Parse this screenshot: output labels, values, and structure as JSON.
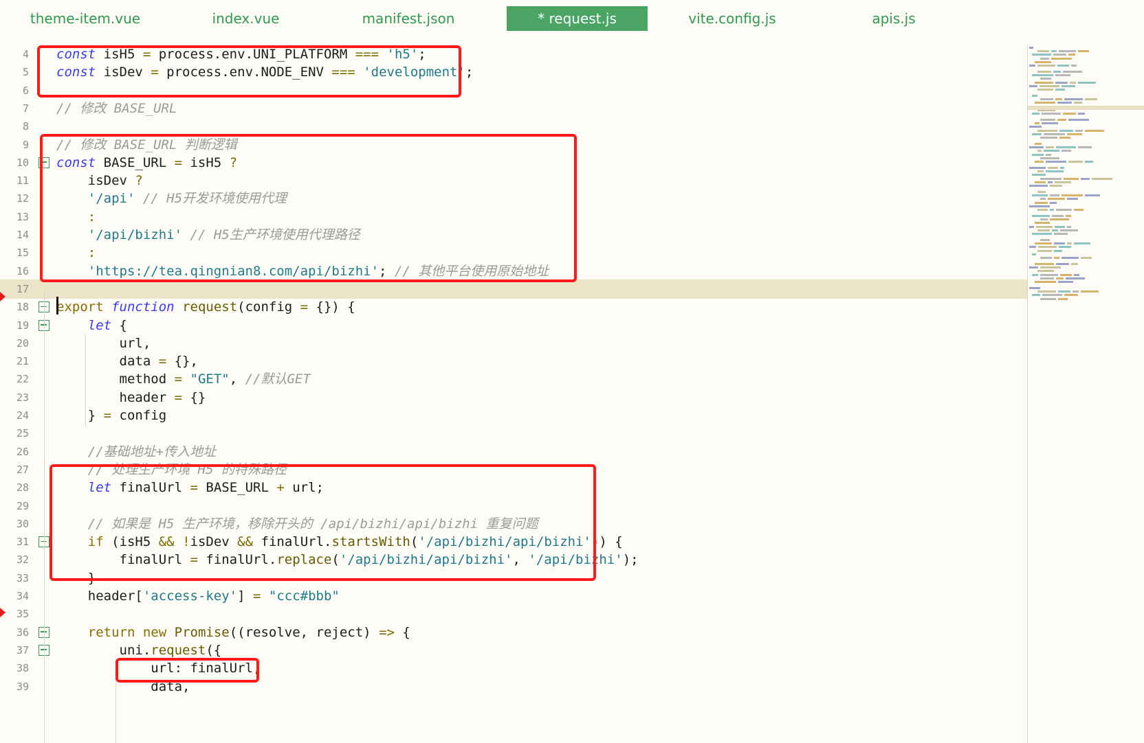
{
  "tabs": [
    {
      "label": "theme-item.vue",
      "active": false
    },
    {
      "label": "index.vue",
      "active": false
    },
    {
      "label": "manifest.json",
      "active": false
    },
    {
      "label": "* request.js",
      "active": true
    },
    {
      "label": "vite.config.js",
      "active": false
    },
    {
      "label": "apis.js",
      "active": false
    }
  ],
  "editor": {
    "current_line": 17,
    "lines": [
      {
        "n": "4",
        "tokens": [
          [
            "kw",
            "const"
          ],
          [
            "pl",
            " isH5 "
          ],
          [
            "op",
            "="
          ],
          [
            "pl",
            " process.env.UNI_PLATFORM "
          ],
          [
            "op",
            "==="
          ],
          [
            "pl",
            " "
          ],
          [
            "str",
            "'h5'"
          ],
          [
            "pl",
            ";"
          ]
        ]
      },
      {
        "n": "5",
        "tokens": [
          [
            "kw",
            "const"
          ],
          [
            "pl",
            " isDev "
          ],
          [
            "op",
            "="
          ],
          [
            "pl",
            " process.env.NODE_ENV "
          ],
          [
            "op",
            "==="
          ],
          [
            "pl",
            " "
          ],
          [
            "str",
            "'development'"
          ],
          [
            "pl",
            ";"
          ]
        ]
      },
      {
        "n": "6",
        "tokens": []
      },
      {
        "n": "7",
        "tokens": [
          [
            "cm",
            "// 修改 BASE_URL"
          ]
        ]
      },
      {
        "n": "8",
        "tokens": []
      },
      {
        "n": "9",
        "tokens": [
          [
            "cm",
            "// 修改 BASE_URL 判断逻辑"
          ]
        ]
      },
      {
        "n": "10",
        "fold": true,
        "tokens": [
          [
            "kw",
            "const"
          ],
          [
            "pl",
            " BASE_URL "
          ],
          [
            "op",
            "="
          ],
          [
            "pl",
            " isH5 "
          ],
          [
            "op",
            "?"
          ]
        ]
      },
      {
        "n": "11",
        "tokens": [
          [
            "pl",
            "    isDev "
          ],
          [
            "op",
            "?"
          ]
        ]
      },
      {
        "n": "12",
        "tokens": [
          [
            "pl",
            "    "
          ],
          [
            "str",
            "'/api'"
          ],
          [
            "pl",
            " "
          ],
          [
            "cm",
            "// H5开发环境使用代理"
          ]
        ]
      },
      {
        "n": "13",
        "tokens": [
          [
            "pl",
            "    "
          ],
          [
            "op",
            ":"
          ]
        ]
      },
      {
        "n": "14",
        "tokens": [
          [
            "pl",
            "    "
          ],
          [
            "str",
            "'/api/bizhi'"
          ],
          [
            "pl",
            " "
          ],
          [
            "cm",
            "// H5生产环境使用代理路径"
          ]
        ]
      },
      {
        "n": "15",
        "tokens": [
          [
            "pl",
            "    "
          ],
          [
            "op",
            ":"
          ]
        ]
      },
      {
        "n": "16",
        "tokens": [
          [
            "pl",
            "    "
          ],
          [
            "str",
            "'https://tea.qingnian8.com/api/bizhi'"
          ],
          [
            "pl",
            "; "
          ],
          [
            "cm",
            "// 其他平台使用原始地址"
          ]
        ]
      },
      {
        "n": "17",
        "tokens": []
      },
      {
        "n": "18",
        "fold": true,
        "tokens": [
          [
            "kw2",
            "export"
          ],
          [
            "pl",
            " "
          ],
          [
            "kw",
            "function"
          ],
          [
            "pl",
            " "
          ],
          [
            "fn",
            "request"
          ],
          [
            "pl",
            "(config "
          ],
          [
            "op",
            "="
          ],
          [
            "pl",
            " {}) {"
          ]
        ]
      },
      {
        "n": "19",
        "fold": true,
        "tokens": [
          [
            "pl",
            "    "
          ],
          [
            "kw",
            "let"
          ],
          [
            "pl",
            " {"
          ]
        ]
      },
      {
        "n": "20",
        "tokens": [
          [
            "pl",
            "        url,"
          ]
        ]
      },
      {
        "n": "21",
        "tokens": [
          [
            "pl",
            "        data "
          ],
          [
            "op",
            "="
          ],
          [
            "pl",
            " {},"
          ]
        ]
      },
      {
        "n": "22",
        "tokens": [
          [
            "pl",
            "        method "
          ],
          [
            "op",
            "="
          ],
          [
            "pl",
            " "
          ],
          [
            "str",
            "\"GET\""
          ],
          [
            "pl",
            ", "
          ],
          [
            "cm",
            "//默认GET"
          ]
        ]
      },
      {
        "n": "23",
        "tokens": [
          [
            "pl",
            "        header "
          ],
          [
            "op",
            "="
          ],
          [
            "pl",
            " {}"
          ]
        ]
      },
      {
        "n": "24",
        "tokens": [
          [
            "pl",
            "    } "
          ],
          [
            "op",
            "="
          ],
          [
            "pl",
            " config"
          ]
        ]
      },
      {
        "n": "25",
        "tokens": []
      },
      {
        "n": "26",
        "tokens": [
          [
            "pl",
            "    "
          ],
          [
            "cm",
            "//基础地址+传入地址"
          ]
        ]
      },
      {
        "n": "27",
        "tokens": [
          [
            "pl",
            "    "
          ],
          [
            "cm",
            "// 处理生产环境 H5 的特殊路径"
          ]
        ]
      },
      {
        "n": "28",
        "tokens": [
          [
            "pl",
            "    "
          ],
          [
            "kw",
            "let"
          ],
          [
            "pl",
            " finalUrl "
          ],
          [
            "op",
            "="
          ],
          [
            "pl",
            " BASE_URL "
          ],
          [
            "op",
            "+"
          ],
          [
            "pl",
            " url;"
          ]
        ]
      },
      {
        "n": "29",
        "tokens": []
      },
      {
        "n": "30",
        "tokens": [
          [
            "pl",
            "    "
          ],
          [
            "cm",
            "// 如果是 H5 生产环境，移除开头的 /api/bizhi/api/bizhi 重复问题"
          ]
        ]
      },
      {
        "n": "31",
        "fold": true,
        "tokens": [
          [
            "pl",
            "    "
          ],
          [
            "kw2",
            "if"
          ],
          [
            "pl",
            " (isH5 "
          ],
          [
            "op",
            "&&"
          ],
          [
            "pl",
            " "
          ],
          [
            "op",
            "!"
          ],
          [
            "pl",
            "isDev "
          ],
          [
            "op",
            "&&"
          ],
          [
            "pl",
            " finalUrl."
          ],
          [
            "fn",
            "startsWith"
          ],
          [
            "pl",
            "("
          ],
          [
            "str",
            "'/api/bizhi/api/bizhi'"
          ],
          [
            "pl",
            ")) {"
          ]
        ]
      },
      {
        "n": "32",
        "tokens": [
          [
            "pl",
            "        finalUrl "
          ],
          [
            "op",
            "="
          ],
          [
            "pl",
            " finalUrl."
          ],
          [
            "fn",
            "replace"
          ],
          [
            "pl",
            "("
          ],
          [
            "str",
            "'/api/bizhi/api/bizhi'"
          ],
          [
            "pl",
            ", "
          ],
          [
            "str",
            "'/api/bizhi'"
          ],
          [
            "pl",
            ");"
          ]
        ]
      },
      {
        "n": "33",
        "tokens": [
          [
            "pl",
            "    }"
          ]
        ]
      },
      {
        "n": "34",
        "tokens": [
          [
            "pl",
            "    header["
          ],
          [
            "str",
            "'access-key'"
          ],
          [
            "pl",
            "] "
          ],
          [
            "op",
            "="
          ],
          [
            "pl",
            " "
          ],
          [
            "str",
            "\"ccc#bbb\""
          ]
        ]
      },
      {
        "n": "35",
        "tokens": []
      },
      {
        "n": "36",
        "fold": true,
        "tokens": [
          [
            "pl",
            "    "
          ],
          [
            "kw2",
            "return"
          ],
          [
            "pl",
            " "
          ],
          [
            "kw2",
            "new"
          ],
          [
            "pl",
            " "
          ],
          [
            "fn",
            "Promise"
          ],
          [
            "pl",
            "((resolve, reject) "
          ],
          [
            "op",
            "=>"
          ],
          [
            "pl",
            " {"
          ]
        ]
      },
      {
        "n": "37",
        "fold": true,
        "tokens": [
          [
            "pl",
            "        uni."
          ],
          [
            "fn",
            "request"
          ],
          [
            "pl",
            "({"
          ]
        ]
      },
      {
        "n": "38",
        "tokens": [
          [
            "pl",
            "            url: finalUrl,"
          ]
        ]
      },
      {
        "n": "39",
        "tokens": [
          [
            "pl",
            "            data,"
          ]
        ]
      }
    ]
  },
  "colors": {
    "tab_active_bg": "#4aa565",
    "tab_text": "#2f9a4f",
    "highlight_box": "#ff1a1a",
    "current_line_bg": "#ebe4c9"
  }
}
